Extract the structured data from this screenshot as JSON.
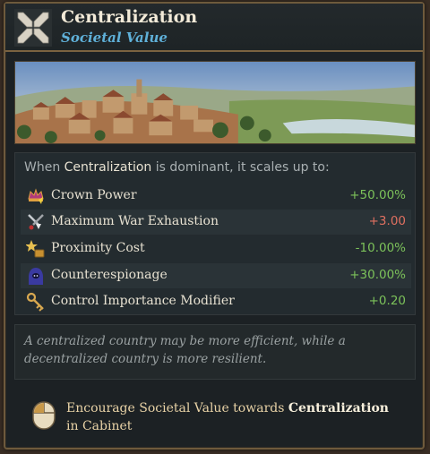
{
  "header": {
    "title": "Centralization",
    "subtitle": "Societal Value",
    "icon": "centralization-arrows-icon"
  },
  "effects": {
    "intro_prefix": "When ",
    "intro_value": "Centralization",
    "intro_suffix": " is dominant, it scales up to:",
    "rows": [
      {
        "icon": "crown-power-icon",
        "label": "Crown Power",
        "value": "+50.00%",
        "color": "#7cc25a"
      },
      {
        "icon": "war-exhaustion-icon",
        "label": "Maximum War Exhaustion",
        "value": "+3.00",
        "color": "#e07060"
      },
      {
        "icon": "proximity-cost-icon",
        "label": "Proximity Cost",
        "value": "-10.00%",
        "color": "#7cc25a"
      },
      {
        "icon": "counterespionage-icon",
        "label": "Counterespionage",
        "value": "+30.00%",
        "color": "#7cc25a"
      },
      {
        "icon": "control-key-icon",
        "label": "Control Importance Modifier",
        "value": "+0.20",
        "color": "#7cc25a"
      }
    ]
  },
  "description": "A centralized country may be more efficient, while a decentralized country is more resilient.",
  "action": {
    "icon": "mouse-icon",
    "prefix": "Encourage Societal Value towards ",
    "highlight": "Centralization",
    "suffix": " in Cabinet"
  }
}
